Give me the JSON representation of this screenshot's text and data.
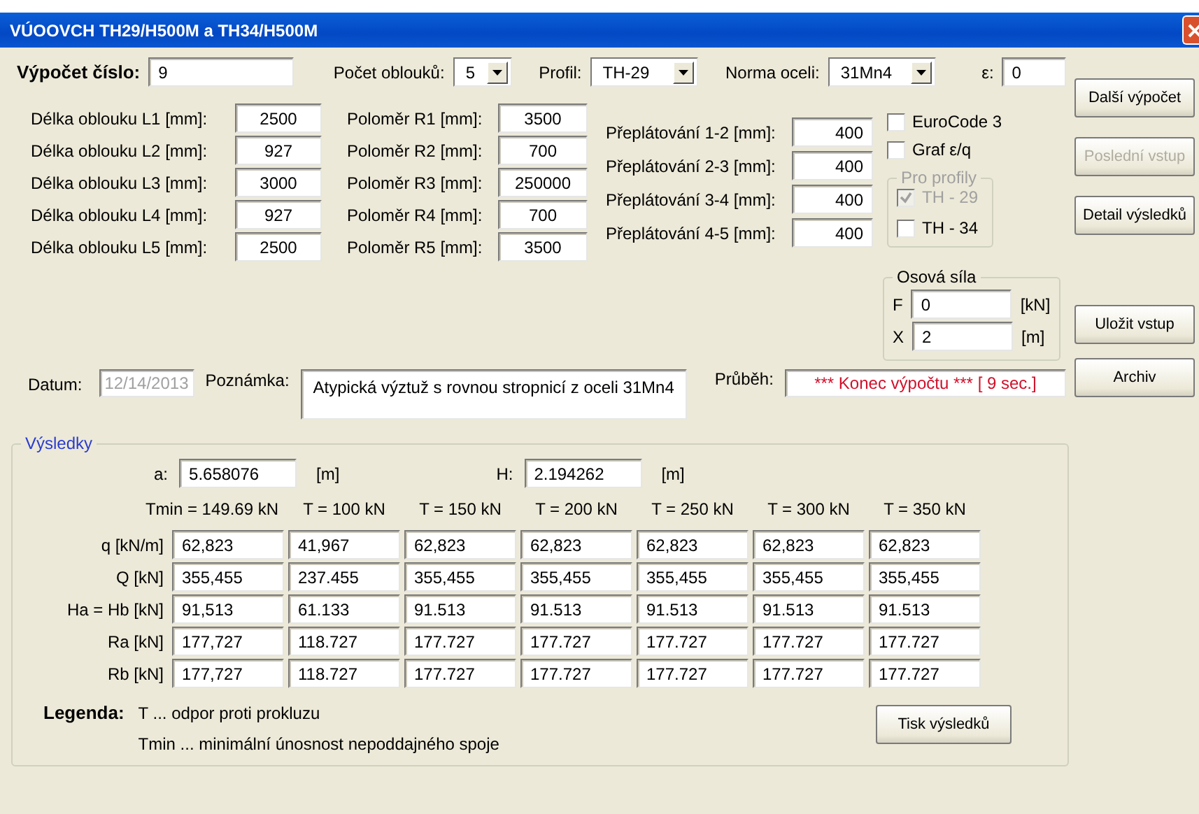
{
  "window": {
    "title": "VÚOOVCH TH29/H500M a TH34/H500M"
  },
  "top": {
    "calc_label": "Výpočet číslo:",
    "calc_value": "9",
    "arch_label": "Počet oblouků:",
    "arch_value": "5",
    "profile_label": "Profil:",
    "profile_value": "TH-29",
    "steel_label": "Norma oceli:",
    "steel_value": "31Mn4",
    "eps_label": "ε:",
    "eps_value": "0"
  },
  "lengths": [
    {
      "label": "Délka oblouku L1 [mm]:",
      "value": "2500"
    },
    {
      "label": "Délka oblouku L2 [mm]:",
      "value": "927"
    },
    {
      "label": "Délka oblouku L3 [mm]:",
      "value": "3000"
    },
    {
      "label": "Délka oblouku L4 [mm]:",
      "value": "927"
    },
    {
      "label": "Délka oblouku L5 [mm]:",
      "value": "2500"
    }
  ],
  "radii": [
    {
      "label": "Poloměr R1  [mm]:",
      "value": "3500"
    },
    {
      "label": "Poloměr R2  [mm]:",
      "value": "700"
    },
    {
      "label": "Poloměr R3  [mm]:",
      "value": "250000"
    },
    {
      "label": "Poloměr R4  [mm]:",
      "value": "700"
    },
    {
      "label": "Poloměr R5  [mm]:",
      "value": "3500"
    }
  ],
  "overlaps": [
    {
      "label": "Přeplátování 1-2  [mm]:",
      "value": "400"
    },
    {
      "label": "Přeplátování 2-3  [mm]:",
      "value": "400"
    },
    {
      "label": "Přeplátování 3-4  [mm]:",
      "value": "400"
    },
    {
      "label": "Přeplátování 4-5  [mm]:",
      "value": "400"
    }
  ],
  "options": [
    {
      "label": "EuroCode 3",
      "checked": false,
      "disabled": false
    },
    {
      "label": "Graf  ε/q",
      "checked": false,
      "disabled": false
    }
  ],
  "profiles_group": {
    "title": "Pro profily",
    "disabled": true,
    "items": [
      {
        "label": "TH - 29",
        "checked": true,
        "disabled": true
      },
      {
        "label": "TH - 34",
        "checked": false,
        "disabled": false
      }
    ]
  },
  "axial_force": {
    "title": "Osová síla",
    "rows": [
      {
        "label": "F",
        "value": "0",
        "unit": "[kN]"
      },
      {
        "label": "X",
        "value": "2",
        "unit": "[m]"
      }
    ]
  },
  "buttons_top": [
    {
      "label": "Další výpočet",
      "disabled": false
    },
    {
      "label": "Poslední vstup",
      "disabled": true
    },
    {
      "label": "Detail výsledků",
      "disabled": false
    }
  ],
  "buttons_bottom": [
    {
      "label": "Uložit vstup",
      "disabled": false
    },
    {
      "label": "Archiv",
      "disabled": false
    }
  ],
  "date": {
    "label": "Datum:",
    "value": "12/14/2013",
    "disabled": true
  },
  "note": {
    "label": "Poznámka:",
    "value": "Atypická výztuž s rovnou stropnicí z oceli 31Mn4"
  },
  "progress": {
    "label": "Průběh:",
    "value": "*** Konec výpočtu *** [ 9 sec.]"
  },
  "results": {
    "title": "Výsledky",
    "a_label": "a:",
    "a_value": "5.658076",
    "a_unit": "[m]",
    "h_label": "H:",
    "h_value": "2.194262",
    "h_unit": "[m]",
    "columns": [
      "Tmin =  149.69 kN",
      "T = 100 kN",
      "T = 150 kN",
      "T = 200 kN",
      "T = 250 kN",
      "T = 300 kN",
      "T = 350 kN"
    ],
    "rows": [
      {
        "label": "q [kN/m]",
        "values": [
          "62,823",
          "41,967",
          "62,823",
          "62,823",
          "62,823",
          "62,823",
          "62,823"
        ]
      },
      {
        "label": "Q [kN]",
        "values": [
          "355,455",
          "237.455",
          "355,455",
          "355,455",
          "355,455",
          "355,455",
          "355,455"
        ]
      },
      {
        "label": "Ha = Hb [kN]",
        "values": [
          "91,513",
          "61.133",
          "91.513",
          "91.513",
          "91.513",
          "91.513",
          "91.513"
        ]
      },
      {
        "label": "Ra [kN]",
        "values": [
          "177,727",
          "118.727",
          "177.727",
          "177.727",
          "177.727",
          "177.727",
          "177.727"
        ]
      },
      {
        "label": "Rb  [kN]",
        "values": [
          "177,727",
          "118.727",
          "177.727",
          "177.727",
          "177.727",
          "177.727",
          "177.727"
        ]
      }
    ],
    "legend_label": "Legenda:",
    "legend": [
      "T ... odpor proti prokluzu",
      "Tmin ... minimální únosnost nepoddajného spoje"
    ],
    "print_button": "Tisk výsledků"
  }
}
